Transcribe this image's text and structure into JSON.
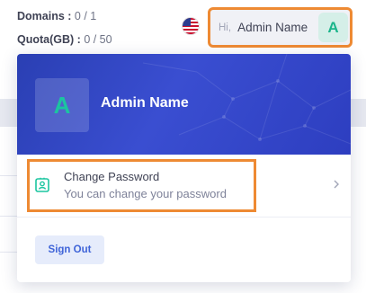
{
  "header": {
    "domains_label": "Domains :",
    "domains_value": "0 / 1",
    "quota_label": "Quota(GB) :",
    "quota_value": "0 / 50",
    "greeting": "Hi,",
    "user_name": "Admin Name",
    "avatar_letter": "A",
    "flag_icon": "us-flag-icon"
  },
  "dropdown": {
    "avatar_letter": "A",
    "user_name": "Admin Name",
    "menu": {
      "title": "Change Password",
      "subtitle": "You can change your password",
      "icon": "id-card-icon"
    },
    "signout_label": "Sign Out"
  },
  "colors": {
    "accent": "#3f64d8",
    "avatar_green": "#1bc5a0",
    "header_blue": "#2e42c3",
    "highlight_orange": "#ee8a33"
  }
}
